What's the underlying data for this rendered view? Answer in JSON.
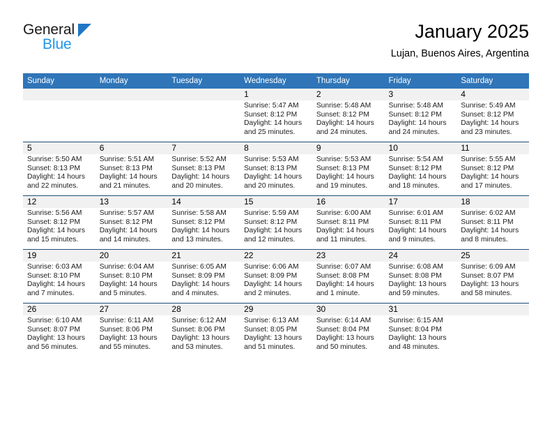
{
  "brand": {
    "name_part1": "General",
    "name_part2": "Blue",
    "triangle_color": "#1f77c4",
    "blue_text_color": "#2196e8"
  },
  "header": {
    "title": "January 2025",
    "subtitle": "Lujan, Buenos Aires, Argentina"
  },
  "theme": {
    "header_blue": "#2f75b8",
    "row_divider": "#1f4e79",
    "day_strip_gray": "#f1f1f1"
  },
  "calendar": {
    "weekday_headers": [
      "Sunday",
      "Monday",
      "Tuesday",
      "Wednesday",
      "Thursday",
      "Friday",
      "Saturday"
    ],
    "weeks": [
      [
        {
          "day": "",
          "sunrise": "",
          "sunset": "",
          "daylight": ""
        },
        {
          "day": "",
          "sunrise": "",
          "sunset": "",
          "daylight": ""
        },
        {
          "day": "",
          "sunrise": "",
          "sunset": "",
          "daylight": ""
        },
        {
          "day": "1",
          "sunrise": "Sunrise: 5:47 AM",
          "sunset": "Sunset: 8:12 PM",
          "daylight": "Daylight: 14 hours and 25 minutes."
        },
        {
          "day": "2",
          "sunrise": "Sunrise: 5:48 AM",
          "sunset": "Sunset: 8:12 PM",
          "daylight": "Daylight: 14 hours and 24 minutes."
        },
        {
          "day": "3",
          "sunrise": "Sunrise: 5:48 AM",
          "sunset": "Sunset: 8:12 PM",
          "daylight": "Daylight: 14 hours and 24 minutes."
        },
        {
          "day": "4",
          "sunrise": "Sunrise: 5:49 AM",
          "sunset": "Sunset: 8:12 PM",
          "daylight": "Daylight: 14 hours and 23 minutes."
        }
      ],
      [
        {
          "day": "5",
          "sunrise": "Sunrise: 5:50 AM",
          "sunset": "Sunset: 8:13 PM",
          "daylight": "Daylight: 14 hours and 22 minutes."
        },
        {
          "day": "6",
          "sunrise": "Sunrise: 5:51 AM",
          "sunset": "Sunset: 8:13 PM",
          "daylight": "Daylight: 14 hours and 21 minutes."
        },
        {
          "day": "7",
          "sunrise": "Sunrise: 5:52 AM",
          "sunset": "Sunset: 8:13 PM",
          "daylight": "Daylight: 14 hours and 20 minutes."
        },
        {
          "day": "8",
          "sunrise": "Sunrise: 5:53 AM",
          "sunset": "Sunset: 8:13 PM",
          "daylight": "Daylight: 14 hours and 20 minutes."
        },
        {
          "day": "9",
          "sunrise": "Sunrise: 5:53 AM",
          "sunset": "Sunset: 8:13 PM",
          "daylight": "Daylight: 14 hours and 19 minutes."
        },
        {
          "day": "10",
          "sunrise": "Sunrise: 5:54 AM",
          "sunset": "Sunset: 8:12 PM",
          "daylight": "Daylight: 14 hours and 18 minutes."
        },
        {
          "day": "11",
          "sunrise": "Sunrise: 5:55 AM",
          "sunset": "Sunset: 8:12 PM",
          "daylight": "Daylight: 14 hours and 17 minutes."
        }
      ],
      [
        {
          "day": "12",
          "sunrise": "Sunrise: 5:56 AM",
          "sunset": "Sunset: 8:12 PM",
          "daylight": "Daylight: 14 hours and 15 minutes."
        },
        {
          "day": "13",
          "sunrise": "Sunrise: 5:57 AM",
          "sunset": "Sunset: 8:12 PM",
          "daylight": "Daylight: 14 hours and 14 minutes."
        },
        {
          "day": "14",
          "sunrise": "Sunrise: 5:58 AM",
          "sunset": "Sunset: 8:12 PM",
          "daylight": "Daylight: 14 hours and 13 minutes."
        },
        {
          "day": "15",
          "sunrise": "Sunrise: 5:59 AM",
          "sunset": "Sunset: 8:12 PM",
          "daylight": "Daylight: 14 hours and 12 minutes."
        },
        {
          "day": "16",
          "sunrise": "Sunrise: 6:00 AM",
          "sunset": "Sunset: 8:11 PM",
          "daylight": "Daylight: 14 hours and 11 minutes."
        },
        {
          "day": "17",
          "sunrise": "Sunrise: 6:01 AM",
          "sunset": "Sunset: 8:11 PM",
          "daylight": "Daylight: 14 hours and 9 minutes."
        },
        {
          "day": "18",
          "sunrise": "Sunrise: 6:02 AM",
          "sunset": "Sunset: 8:11 PM",
          "daylight": "Daylight: 14 hours and 8 minutes."
        }
      ],
      [
        {
          "day": "19",
          "sunrise": "Sunrise: 6:03 AM",
          "sunset": "Sunset: 8:10 PM",
          "daylight": "Daylight: 14 hours and 7 minutes."
        },
        {
          "day": "20",
          "sunrise": "Sunrise: 6:04 AM",
          "sunset": "Sunset: 8:10 PM",
          "daylight": "Daylight: 14 hours and 5 minutes."
        },
        {
          "day": "21",
          "sunrise": "Sunrise: 6:05 AM",
          "sunset": "Sunset: 8:09 PM",
          "daylight": "Daylight: 14 hours and 4 minutes."
        },
        {
          "day": "22",
          "sunrise": "Sunrise: 6:06 AM",
          "sunset": "Sunset: 8:09 PM",
          "daylight": "Daylight: 14 hours and 2 minutes."
        },
        {
          "day": "23",
          "sunrise": "Sunrise: 6:07 AM",
          "sunset": "Sunset: 8:08 PM",
          "daylight": "Daylight: 14 hours and 1 minute."
        },
        {
          "day": "24",
          "sunrise": "Sunrise: 6:08 AM",
          "sunset": "Sunset: 8:08 PM",
          "daylight": "Daylight: 13 hours and 59 minutes."
        },
        {
          "day": "25",
          "sunrise": "Sunrise: 6:09 AM",
          "sunset": "Sunset: 8:07 PM",
          "daylight": "Daylight: 13 hours and 58 minutes."
        }
      ],
      [
        {
          "day": "26",
          "sunrise": "Sunrise: 6:10 AM",
          "sunset": "Sunset: 8:07 PM",
          "daylight": "Daylight: 13 hours and 56 minutes."
        },
        {
          "day": "27",
          "sunrise": "Sunrise: 6:11 AM",
          "sunset": "Sunset: 8:06 PM",
          "daylight": "Daylight: 13 hours and 55 minutes."
        },
        {
          "day": "28",
          "sunrise": "Sunrise: 6:12 AM",
          "sunset": "Sunset: 8:06 PM",
          "daylight": "Daylight: 13 hours and 53 minutes."
        },
        {
          "day": "29",
          "sunrise": "Sunrise: 6:13 AM",
          "sunset": "Sunset: 8:05 PM",
          "daylight": "Daylight: 13 hours and 51 minutes."
        },
        {
          "day": "30",
          "sunrise": "Sunrise: 6:14 AM",
          "sunset": "Sunset: 8:04 PM",
          "daylight": "Daylight: 13 hours and 50 minutes."
        },
        {
          "day": "31",
          "sunrise": "Sunrise: 6:15 AM",
          "sunset": "Sunset: 8:04 PM",
          "daylight": "Daylight: 13 hours and 48 minutes."
        },
        {
          "day": "",
          "sunrise": "",
          "sunset": "",
          "daylight": ""
        }
      ]
    ]
  }
}
